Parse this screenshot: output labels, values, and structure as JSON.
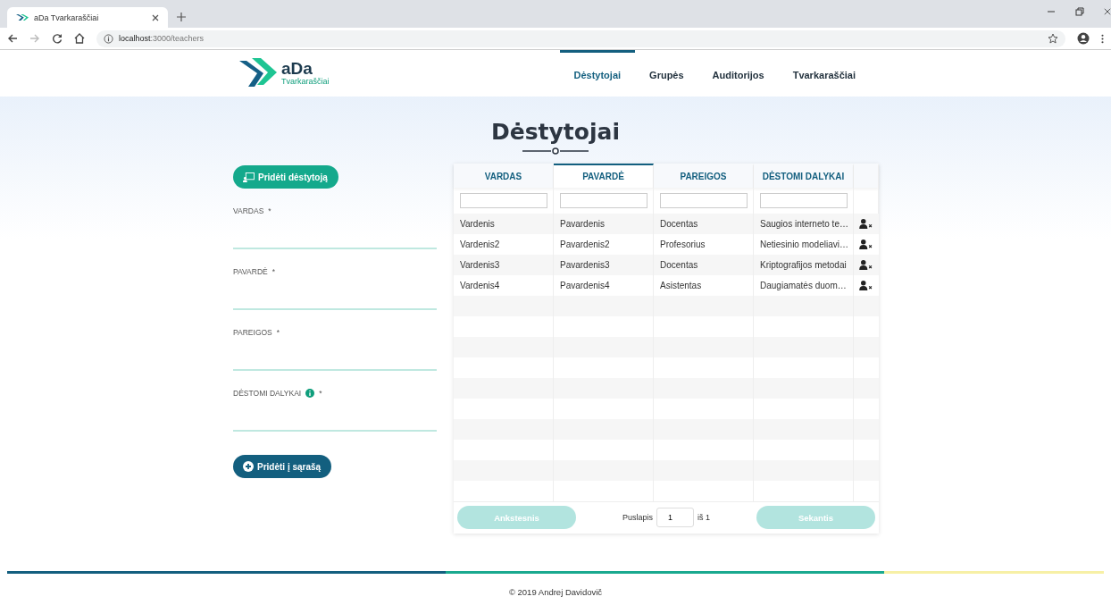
{
  "browser": {
    "tab_title": "aDa Tvarkaraščiai",
    "url_host": "localhost",
    "url_path": ":3000/teachers"
  },
  "header": {
    "logo_title": "aDa",
    "logo_subtitle": "Tvarkaraščiai",
    "nav": [
      {
        "label": "Dėstytojai",
        "selected": true
      },
      {
        "label": "Grupės",
        "selected": false
      },
      {
        "label": "Auditorijos",
        "selected": false
      },
      {
        "label": "Tvarkaraščiai",
        "selected": false
      }
    ]
  },
  "page_title": "Dėstytojai",
  "form": {
    "add_teacher_button": "Pridėti dėstytoją",
    "fields": [
      {
        "label": "VARDAS",
        "required": "*"
      },
      {
        "label": "PAVARDĖ",
        "required": "*"
      },
      {
        "label": "PAREIGOS",
        "required": "*"
      },
      {
        "label": "DĖSTOMI DALYKAI",
        "required": "*",
        "info": true
      }
    ],
    "submit_button": "Pridėti į sąrašą"
  },
  "table": {
    "columns": [
      {
        "label": "VARDAS",
        "sorted": false
      },
      {
        "label": "PAVARDĖ",
        "sorted": true
      },
      {
        "label": "PAREIGOS",
        "sorted": false
      },
      {
        "label": "DĖSTOMI DALYKAI",
        "sorted": false
      }
    ],
    "rows": [
      [
        "Vardenis",
        "Pavardenis",
        "Docentas",
        "Saugios interneto te…"
      ],
      [
        "Vardenis2",
        "Pavardenis2",
        "Profesorius",
        "Netiesinio modeliavi…"
      ],
      [
        "Vardenis3",
        "Pavardenis3",
        "Docentas",
        "Kriptografijos metodai"
      ],
      [
        "Vardenis4",
        "Pavardenis4",
        "Asistentas",
        "Daugiamatės duom…"
      ]
    ],
    "pagination": {
      "previous": "Ankstesnis",
      "page_label": "Puslapis",
      "page": "1",
      "of_label": "iš 1",
      "next": "Sekantis"
    }
  },
  "footer": "© 2019 Andrej Davidovič"
}
